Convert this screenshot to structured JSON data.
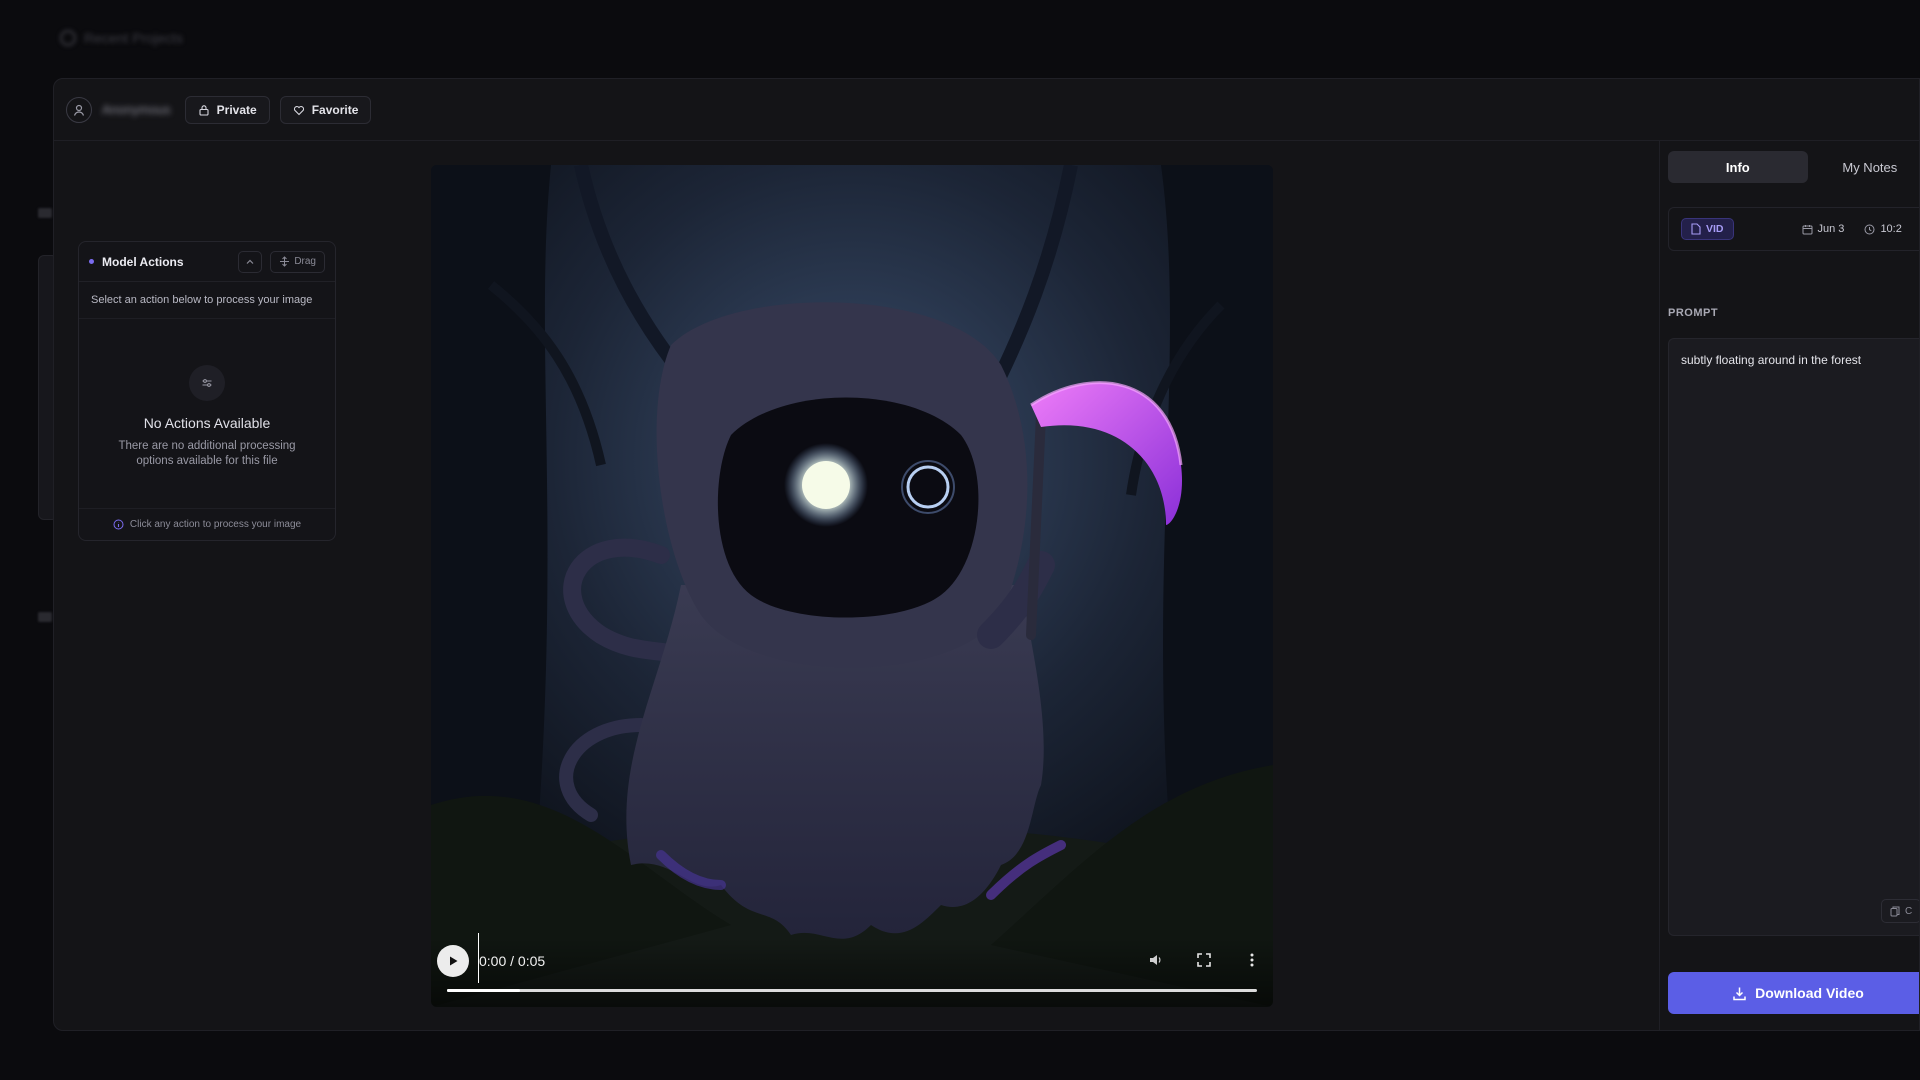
{
  "app": {
    "title": "Recent Projects",
    "user_name": "Anonymous"
  },
  "header": {
    "private_label": "Private",
    "favorite_label": "Favorite"
  },
  "model_actions": {
    "title": "Model Actions",
    "drag_label": "Drag",
    "subtitle": "Select an action below to process your image",
    "empty_title": "No Actions Available",
    "empty_description": "There are no additional processing options available for this file",
    "footer_hint": "Click any action to process your image"
  },
  "video": {
    "time_display": "0:00 / 0:05",
    "buffered_fraction": 0.09
  },
  "panel": {
    "tabs": [
      {
        "label": "Info",
        "active": true
      },
      {
        "label": "My Notes",
        "active": false
      }
    ],
    "badge": "VID",
    "date": "Jun 3",
    "time": "10:2",
    "prompt_label": "PROMPT",
    "prompt_text": "subtly floating around in the forest",
    "copy_label": "C",
    "download_label": "Download Video"
  },
  "colors": {
    "accent": "#5b5ee6",
    "badge": "#a79cf6",
    "scythe_glow": "#c04ce8"
  }
}
